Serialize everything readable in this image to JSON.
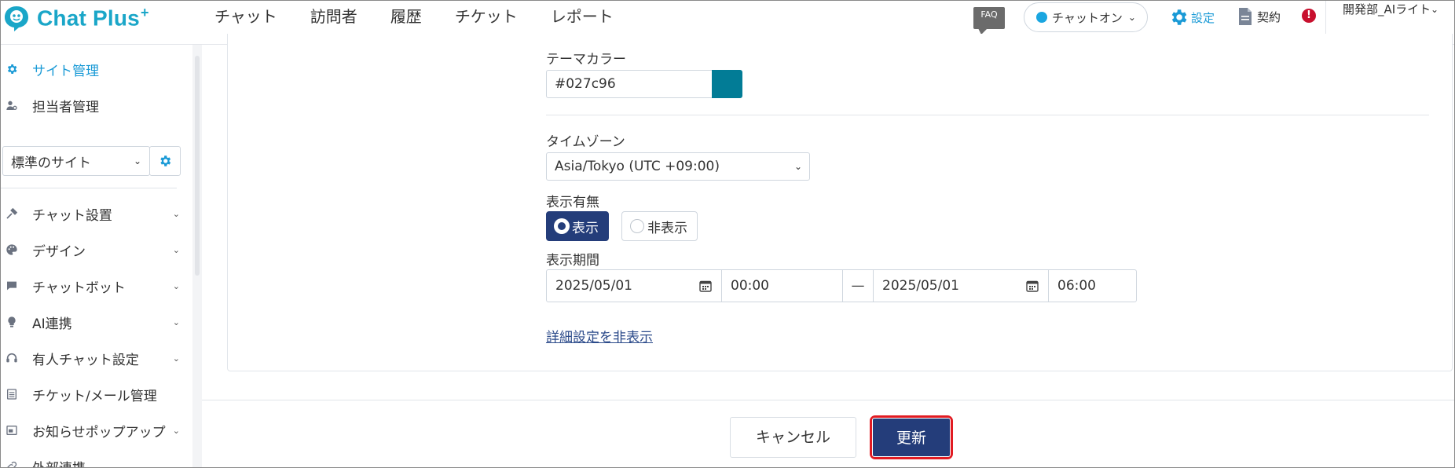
{
  "app": {
    "logo_text": "Chat Plus",
    "logo_plus": "+"
  },
  "nav": {
    "items": [
      "チャット",
      "訪問者",
      "履歴",
      "チケット",
      "レポート"
    ]
  },
  "header": {
    "faq_label": "FAQ",
    "status_label": "チャットオン",
    "status_color": "#1aa6e0",
    "settings_label": "設定",
    "contract_label": "契約",
    "alert_symbol": "!",
    "user_label": "開発部_AIライト"
  },
  "sidebar": {
    "top_items": [
      {
        "label": "サイト管理",
        "icon": "gear-icon",
        "active": true
      },
      {
        "label": "担当者管理",
        "icon": "user-gear-icon",
        "active": false
      }
    ],
    "site_select": {
      "value": "標準のサイト"
    },
    "menu_items": [
      {
        "label": "チャット設置",
        "icon": "tools-icon"
      },
      {
        "label": "デザイン",
        "icon": "palette-icon"
      },
      {
        "label": "チャットボット",
        "icon": "chat-bubble-icon"
      },
      {
        "label": "AI連携",
        "icon": "lightbulb-icon"
      },
      {
        "label": "有人チャット設定",
        "icon": "headset-icon"
      },
      {
        "label": "チケット/メール管理",
        "icon": "list-icon"
      },
      {
        "label": "お知らせポップアップ",
        "icon": "popup-icon"
      },
      {
        "label": "外部連携",
        "icon": "link-icon"
      }
    ]
  },
  "form": {
    "theme_color": {
      "label": "テーマカラー",
      "value": "#027c96",
      "swatch": "#027c96"
    },
    "timezone": {
      "label": "タイムゾーン",
      "value": "Asia/Tokyo (UTC +09:00)"
    },
    "visibility": {
      "label": "表示有無",
      "options": [
        "表示",
        "非表示"
      ],
      "selected": "表示"
    },
    "period": {
      "label": "表示期間",
      "start_date": "2025/05/01",
      "start_time": "00:00",
      "separator": "—",
      "end_date": "2025/05/01",
      "end_time": "06:00"
    },
    "detail_toggle": "詳細設定を非表示"
  },
  "footer": {
    "cancel_label": "キャンセル",
    "update_label": "更新"
  },
  "colors": {
    "accent": "#1a9ad6",
    "primary_button": "#243d7a",
    "highlight_border": "#e11b22"
  }
}
